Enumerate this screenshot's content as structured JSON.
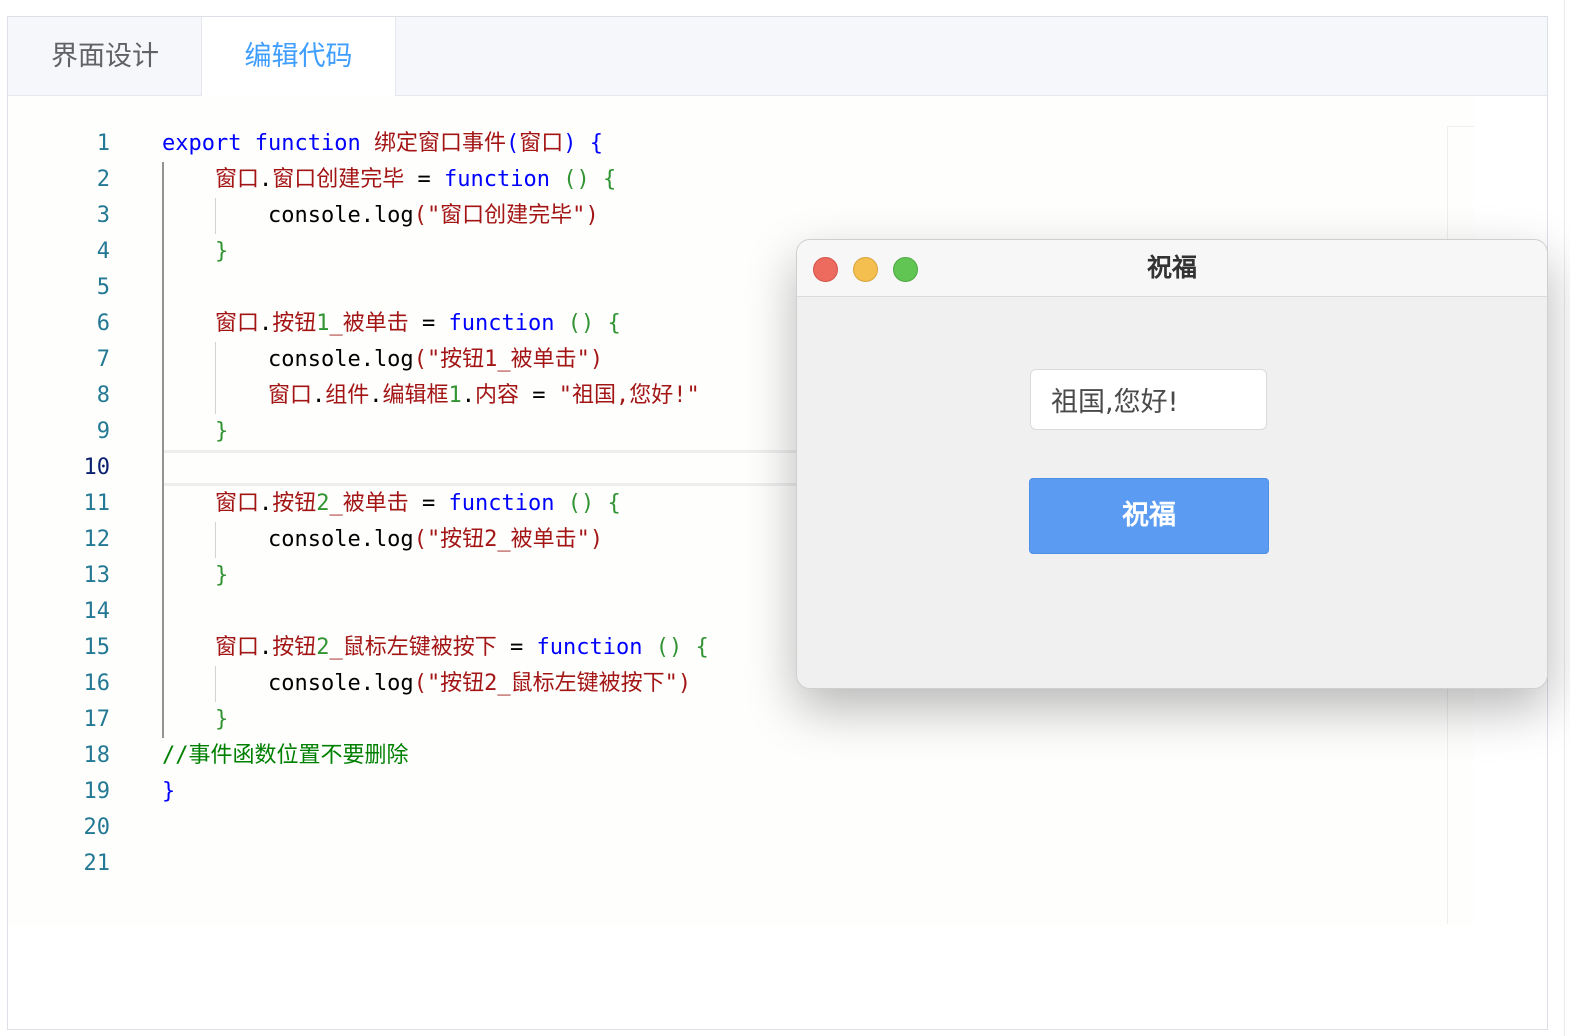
{
  "tabs": [
    {
      "label": "界面设计",
      "active": false
    },
    {
      "label": "编辑代码",
      "active": true
    }
  ],
  "editor": {
    "active_line": 10,
    "line_numbers": [
      "1",
      "2",
      "3",
      "4",
      "5",
      "6",
      "7",
      "8",
      "9",
      "10",
      "11",
      "12",
      "13",
      "14",
      "15",
      "16",
      "17",
      "18",
      "19",
      "20",
      "21"
    ],
    "lines": [
      [
        {
          "t": "export",
          "c": "k"
        },
        {
          "t": " ",
          "c": "d"
        },
        {
          "t": "function",
          "c": "k"
        },
        {
          "t": " ",
          "c": "d"
        },
        {
          "t": "绑定窗口事件",
          "c": "id"
        },
        {
          "t": "(",
          "c": "k"
        },
        {
          "t": "窗口",
          "c": "id"
        },
        {
          "t": ")",
          "c": "k"
        },
        {
          "t": " ",
          "c": "d"
        },
        {
          "t": "{",
          "c": "k"
        }
      ],
      [
        {
          "t": "    ",
          "c": "d"
        },
        {
          "t": "窗口",
          "c": "id"
        },
        {
          "t": ".",
          "c": "d"
        },
        {
          "t": "窗口创建完毕",
          "c": "id"
        },
        {
          "t": " = ",
          "c": "d"
        },
        {
          "t": "function",
          "c": "k"
        },
        {
          "t": " ",
          "c": "d"
        },
        {
          "t": "()",
          "c": "g"
        },
        {
          "t": " ",
          "c": "d"
        },
        {
          "t": "{",
          "c": "g"
        }
      ],
      [
        {
          "t": "        ",
          "c": "d"
        },
        {
          "t": "console",
          "c": "d"
        },
        {
          "t": ".",
          "c": "d"
        },
        {
          "t": "log",
          "c": "d"
        },
        {
          "t": "(",
          "c": "s"
        },
        {
          "t": "\"窗口创建完毕\"",
          "c": "s"
        },
        {
          "t": ")",
          "c": "s"
        }
      ],
      [
        {
          "t": "    ",
          "c": "d"
        },
        {
          "t": "}",
          "c": "g"
        }
      ],
      [],
      [
        {
          "t": "    ",
          "c": "d"
        },
        {
          "t": "窗口",
          "c": "id"
        },
        {
          "t": ".",
          "c": "d"
        },
        {
          "t": "按钮",
          "c": "id"
        },
        {
          "t": "1",
          "c": "g"
        },
        {
          "t": "_被单击",
          "c": "id"
        },
        {
          "t": " = ",
          "c": "d"
        },
        {
          "t": "function",
          "c": "k"
        },
        {
          "t": " ",
          "c": "d"
        },
        {
          "t": "()",
          "c": "g"
        },
        {
          "t": " ",
          "c": "d"
        },
        {
          "t": "{",
          "c": "g"
        }
      ],
      [
        {
          "t": "        ",
          "c": "d"
        },
        {
          "t": "console",
          "c": "d"
        },
        {
          "t": ".",
          "c": "d"
        },
        {
          "t": "log",
          "c": "d"
        },
        {
          "t": "(",
          "c": "s"
        },
        {
          "t": "\"按钮1_被单击\"",
          "c": "s"
        },
        {
          "t": ")",
          "c": "s"
        }
      ],
      [
        {
          "t": "        ",
          "c": "d"
        },
        {
          "t": "窗口",
          "c": "id"
        },
        {
          "t": ".",
          "c": "d"
        },
        {
          "t": "组件",
          "c": "id"
        },
        {
          "t": ".",
          "c": "d"
        },
        {
          "t": "编辑框",
          "c": "id"
        },
        {
          "t": "1",
          "c": "g"
        },
        {
          "t": ".",
          "c": "d"
        },
        {
          "t": "内容",
          "c": "id"
        },
        {
          "t": " = ",
          "c": "d"
        },
        {
          "t": "\"祖国,您好!\"",
          "c": "s"
        }
      ],
      [
        {
          "t": "    ",
          "c": "d"
        },
        {
          "t": "}",
          "c": "g"
        }
      ],
      [],
      [
        {
          "t": "    ",
          "c": "d"
        },
        {
          "t": "窗口",
          "c": "id"
        },
        {
          "t": ".",
          "c": "d"
        },
        {
          "t": "按钮",
          "c": "id"
        },
        {
          "t": "2",
          "c": "g"
        },
        {
          "t": "_被单击",
          "c": "id"
        },
        {
          "t": " = ",
          "c": "d"
        },
        {
          "t": "function",
          "c": "k"
        },
        {
          "t": " ",
          "c": "d"
        },
        {
          "t": "()",
          "c": "g"
        },
        {
          "t": " ",
          "c": "d"
        },
        {
          "t": "{",
          "c": "g"
        }
      ],
      [
        {
          "t": "        ",
          "c": "d"
        },
        {
          "t": "console",
          "c": "d"
        },
        {
          "t": ".",
          "c": "d"
        },
        {
          "t": "log",
          "c": "d"
        },
        {
          "t": "(",
          "c": "s"
        },
        {
          "t": "\"按钮2_被单击\"",
          "c": "s"
        },
        {
          "t": ")",
          "c": "s"
        }
      ],
      [
        {
          "t": "    ",
          "c": "d"
        },
        {
          "t": "}",
          "c": "g"
        }
      ],
      [],
      [
        {
          "t": "    ",
          "c": "d"
        },
        {
          "t": "窗口",
          "c": "id"
        },
        {
          "t": ".",
          "c": "d"
        },
        {
          "t": "按钮",
          "c": "id"
        },
        {
          "t": "2",
          "c": "g"
        },
        {
          "t": "_鼠标左键被按下",
          "c": "id"
        },
        {
          "t": " = ",
          "c": "d"
        },
        {
          "t": "function",
          "c": "k"
        },
        {
          "t": " ",
          "c": "d"
        },
        {
          "t": "()",
          "c": "g"
        },
        {
          "t": " ",
          "c": "d"
        },
        {
          "t": "{",
          "c": "g"
        }
      ],
      [
        {
          "t": "        ",
          "c": "d"
        },
        {
          "t": "console",
          "c": "d"
        },
        {
          "t": ".",
          "c": "d"
        },
        {
          "t": "log",
          "c": "d"
        },
        {
          "t": "(",
          "c": "s"
        },
        {
          "t": "\"按钮2_鼠标左键被按下\"",
          "c": "s"
        },
        {
          "t": ")",
          "c": "s"
        }
      ],
      [
        {
          "t": "    ",
          "c": "d"
        },
        {
          "t": "}",
          "c": "g"
        }
      ],
      [
        {
          "t": "//事件函数位置不要删除",
          "c": "c"
        }
      ],
      [
        {
          "t": "}",
          "c": "k"
        }
      ],
      [],
      []
    ]
  },
  "preview_window": {
    "title": "祝福",
    "traffic_lights": [
      "close-icon",
      "minimize-icon",
      "maximize-icon"
    ],
    "input_value": "祖国,您好!",
    "button_label": "祝福"
  },
  "colors": {
    "keyword": "#0000ff",
    "identifier": "#a31515",
    "string": "#a31515",
    "bracket": "#319331",
    "comment": "#008000",
    "line_number": "#237893",
    "active_tab": "#409eff",
    "button": "#5b9cf2"
  }
}
